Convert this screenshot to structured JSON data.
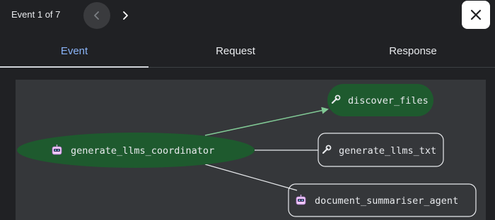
{
  "header": {
    "event_counter": "Event 1 of 7"
  },
  "tabs": [
    {
      "label": "Event",
      "active": true
    },
    {
      "label": "Request",
      "active": false
    },
    {
      "label": "Response",
      "active": false
    }
  ],
  "graph": {
    "nodes": [
      {
        "label": "generate_llms_coordinator",
        "icon": "robot-icon",
        "style": "active-agent"
      },
      {
        "label": "discover_files",
        "icon": "wrench-icon",
        "style": "active-tool"
      },
      {
        "label": "generate_llms_txt",
        "icon": "wrench-icon",
        "style": "tool"
      },
      {
        "label": "document_summariser_agent",
        "icon": "robot-icon",
        "style": "agent"
      }
    ],
    "colors": {
      "active_fill": "#1e5a2e",
      "active_edge": "#81c995",
      "edge": "#e8eaed",
      "accent_tab": "#8ab4f8"
    }
  }
}
